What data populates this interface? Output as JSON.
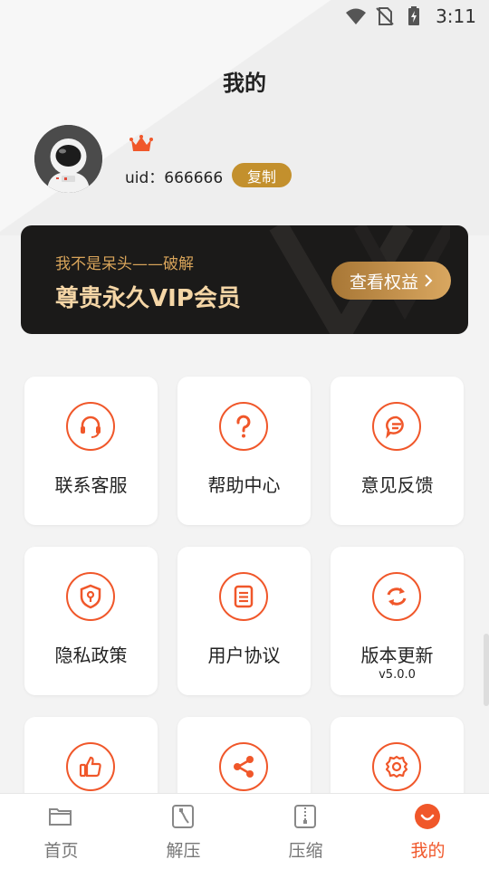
{
  "status_bar": {
    "time": "3:11",
    "icons": [
      "wifi-icon",
      "no-sim-icon",
      "battery-charging-icon"
    ]
  },
  "page": {
    "title": "我的"
  },
  "profile": {
    "uid_label": "uid：666666",
    "copy_label": "复制",
    "avatar_icon": "astronaut-avatar",
    "crown_icon": "crown-icon"
  },
  "vip": {
    "subtitle": "我不是呆头——破解",
    "title": "尊贵永久VIP会员",
    "button_label": "查看权益",
    "button_icon": "chevron-right-icon"
  },
  "tiles": [
    {
      "label": "联系客服",
      "icon": "headset-icon"
    },
    {
      "label": "帮助中心",
      "icon": "question-icon"
    },
    {
      "label": "意见反馈",
      "icon": "chat-icon"
    },
    {
      "label": "隐私政策",
      "icon": "shield-icon"
    },
    {
      "label": "用户协议",
      "icon": "document-icon"
    },
    {
      "label": "版本更新",
      "sub": "v5.0.0",
      "icon": "refresh-icon"
    },
    {
      "label": "",
      "icon": "thumbs-up-icon"
    },
    {
      "label": "",
      "icon": "share-icon"
    },
    {
      "label": "",
      "icon": "settings-icon"
    }
  ],
  "tabs": [
    {
      "label": "首页",
      "icon": "folder-icon",
      "active": false
    },
    {
      "label": "解压",
      "icon": "unzip-icon",
      "active": false
    },
    {
      "label": "压缩",
      "icon": "zip-icon",
      "active": false
    },
    {
      "label": "我的",
      "icon": "smile-icon",
      "active": true
    }
  ],
  "colors": {
    "accent": "#f0572a",
    "gold": "#c3902d",
    "vip_bg": "#1b1a19",
    "vip_text": "#f5d6a6"
  }
}
